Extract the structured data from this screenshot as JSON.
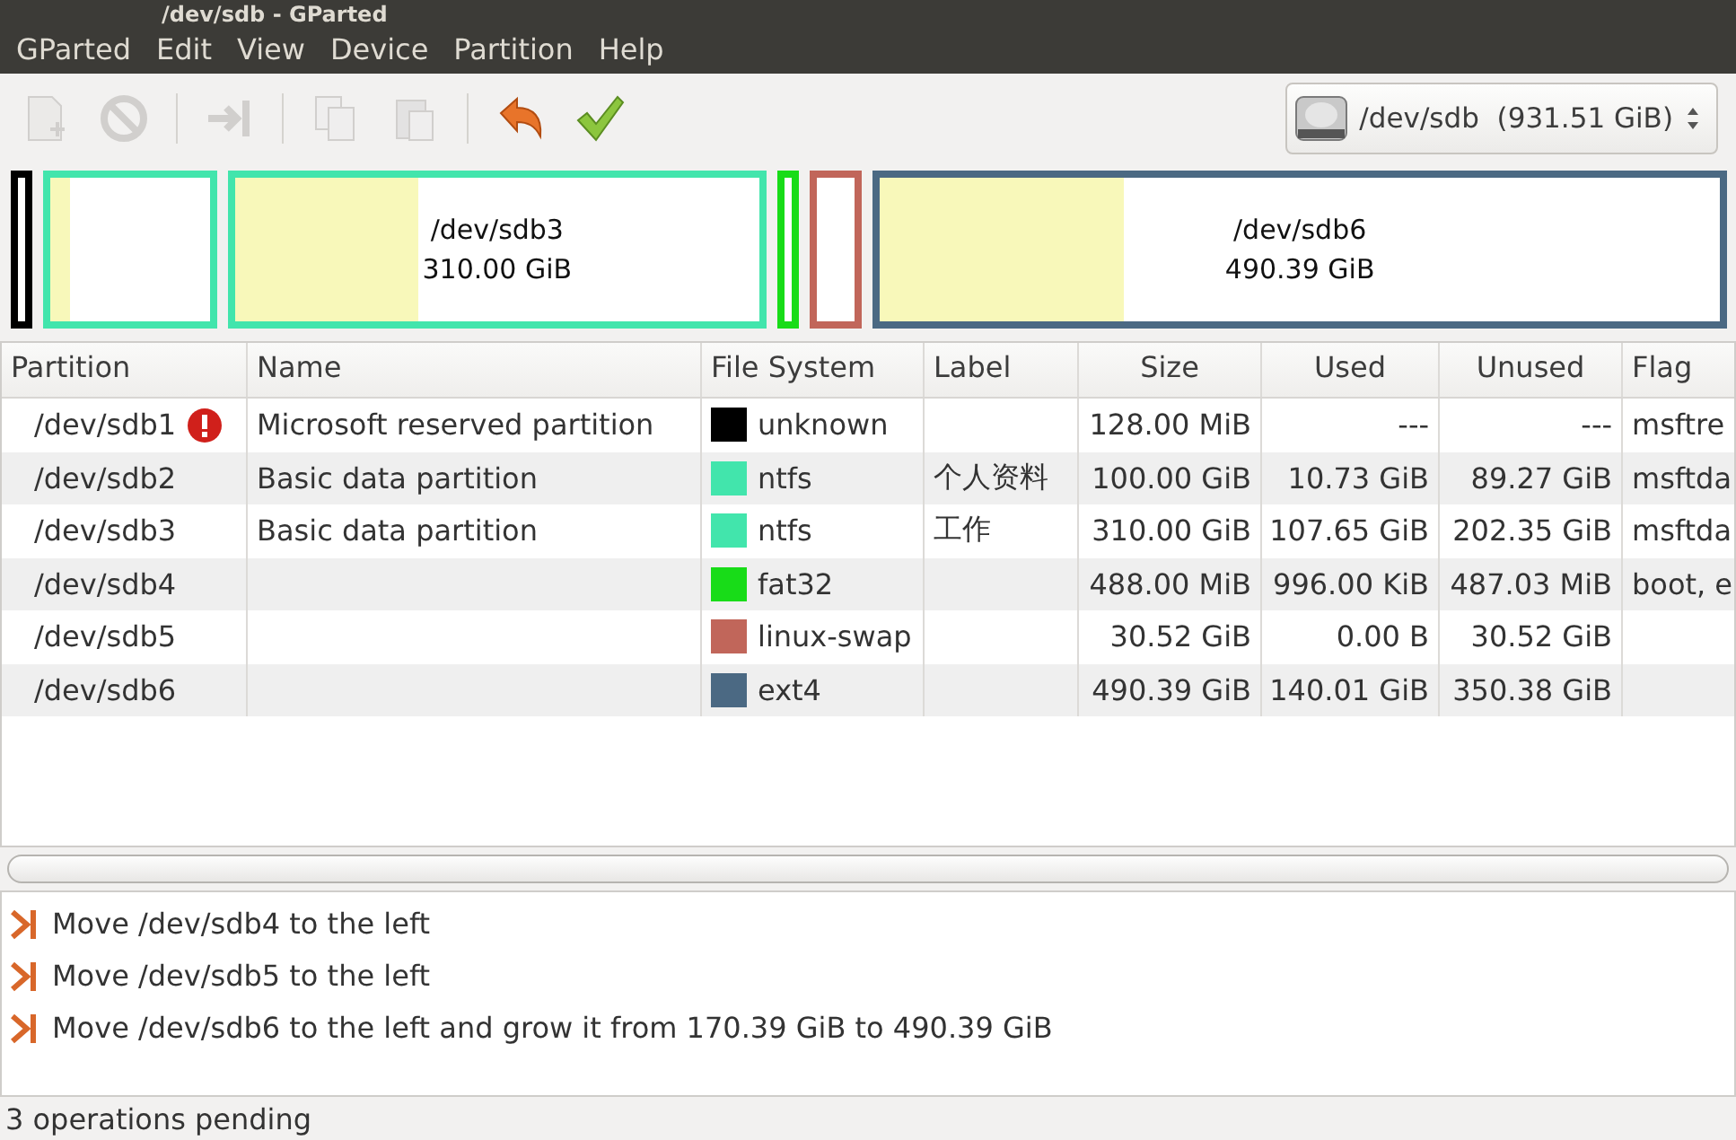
{
  "window": {
    "title": "/dev/sdb - GParted"
  },
  "menu": [
    "GParted",
    "Edit",
    "View",
    "Device",
    "Partition",
    "Help"
  ],
  "toolbar": [
    {
      "kind": "new",
      "disabled": true
    },
    {
      "kind": "delete",
      "disabled": true
    },
    {
      "kind": "sep"
    },
    {
      "kind": "resize",
      "disabled": true
    },
    {
      "kind": "sep"
    },
    {
      "kind": "copy",
      "disabled": true
    },
    {
      "kind": "paste",
      "disabled": true
    },
    {
      "kind": "sep"
    },
    {
      "kind": "undo",
      "disabled": false
    },
    {
      "kind": "apply",
      "disabled": false
    }
  ],
  "device": {
    "label": "/dev/sdb",
    "size": "(931.51 GiB)"
  },
  "disk_map": [
    {
      "color": "#000000"
    },
    {
      "color": "#42e5ac",
      "level": 0.12
    },
    {
      "color": "#42e5ac",
      "level": 0.35,
      "name": "/dev/sdb3",
      "size": "310.00 GiB"
    },
    {
      "color": "#18dc18"
    },
    {
      "color": "#c1665a"
    },
    {
      "color": "#4b6983",
      "level": 0.29,
      "name": "/dev/sdb6",
      "size": "490.39 GiB"
    }
  ],
  "table": {
    "columns": [
      "Partition",
      "Name",
      "File System",
      "Label",
      "Size",
      "Used",
      "Unused",
      "Flag"
    ],
    "rows": [
      {
        "partition": "/dev/sdb1",
        "warning": true,
        "name": "Microsoft reserved partition",
        "color": "#000000",
        "file_system": "unknown",
        "label": "",
        "size": "128.00 MiB",
        "used": "---",
        "unused": "---",
        "flags": "msftre"
      },
      {
        "partition": "/dev/sdb2",
        "warning": false,
        "name": "Basic data partition",
        "color": "#42e5ac",
        "file_system": "ntfs",
        "label": "个人资料",
        "size": "100.00 GiB",
        "used": "10.73 GiB",
        "unused": "89.27 GiB",
        "flags": "msftda"
      },
      {
        "partition": "/dev/sdb3",
        "warning": false,
        "name": "Basic data partition",
        "color": "#42e5ac",
        "file_system": "ntfs",
        "label": "工作",
        "size": "310.00 GiB",
        "used": "107.65 GiB",
        "unused": "202.35 GiB",
        "flags": "msftda"
      },
      {
        "partition": "/dev/sdb4",
        "warning": false,
        "name": "",
        "color": "#18dc18",
        "file_system": "fat32",
        "label": "",
        "size": "488.00 MiB",
        "used": "996.00 KiB",
        "unused": "487.03 MiB",
        "flags": "boot, e"
      },
      {
        "partition": "/dev/sdb5",
        "warning": false,
        "name": "",
        "color": "#c1665a",
        "file_system": "linux-swap",
        "label": "",
        "size": "30.52 GiB",
        "used": "0.00 B",
        "unused": "30.52 GiB",
        "flags": ""
      },
      {
        "partition": "/dev/sdb6",
        "warning": false,
        "name": "",
        "color": "#4b6983",
        "file_system": "ext4",
        "label": "",
        "size": "490.39 GiB",
        "used": "140.01 GiB",
        "unused": "350.38 GiB",
        "flags": ""
      }
    ]
  },
  "operations": [
    "Move /dev/sdb4 to the left",
    "Move /dev/sdb5 to the left",
    "Move /dev/sdb6 to the left and grow it from 170.39 GiB to 490.39 GiB"
  ],
  "status_bar": "3 operations pending"
}
